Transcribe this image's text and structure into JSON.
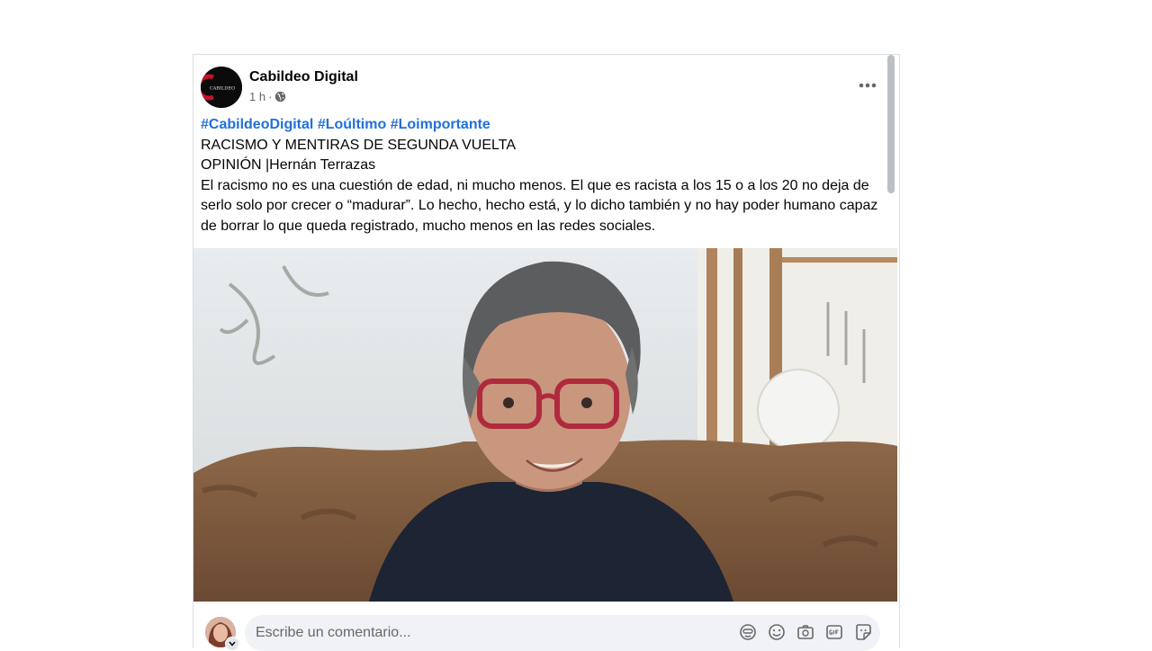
{
  "post": {
    "author": "Cabildeo Digital",
    "avatar_logo_text": "CABILDEO",
    "time": "1 h",
    "separator": "·",
    "privacy_icon": "globe-icon",
    "more_icon": "more-horizontal-icon",
    "hashtags": [
      "#CabildeoDigital",
      "#Loúltimo",
      "#Loimportante"
    ],
    "headline": "RACISMO Y MENTIRAS DE SEGUNDA VUELTA",
    "byline": "OPINIÓN |Hernán Terrazas",
    "body": "El racismo no es una cuestión de edad, ni mucho menos. El que es racista a los 15 o a los 20 no deja de serlo solo por crecer o “madurar”. Lo hecho, hecho está, y lo dicho también y no hay poder humano capaz de borrar lo que queda registrado, mucho menos en las redes sociales.",
    "photo_icon": "portrait-photo"
  },
  "comment": {
    "placeholder": "Escribe un comentario...",
    "tools": [
      "avatar-sticker-icon",
      "emoji-icon",
      "camera-icon",
      "gif-icon",
      "sticker-icon"
    ]
  },
  "colors": {
    "hashtag": "#216fdb",
    "meta": "#65676b",
    "brand_red": "#c8102e"
  }
}
